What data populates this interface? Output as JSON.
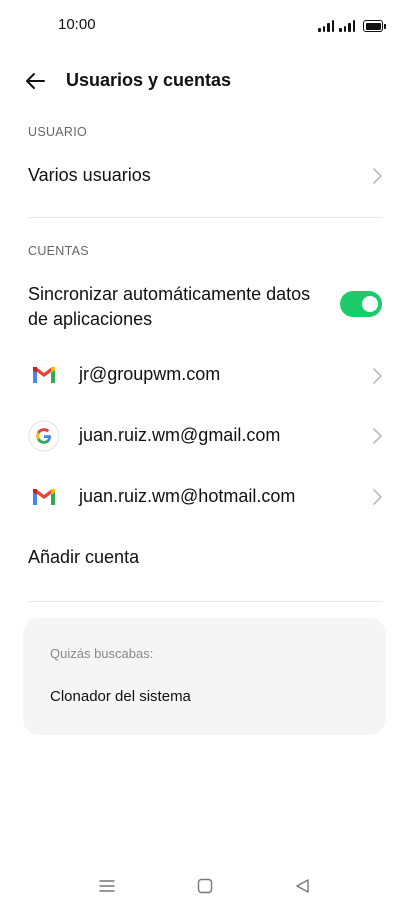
{
  "status_bar": {
    "time": "10:00"
  },
  "header": {
    "title": "Usuarios y cuentas"
  },
  "user_section": {
    "label": "USUARIO",
    "multiple_users": "Varios usuarios"
  },
  "accounts_section": {
    "label": "CUENTAS",
    "sync_label": "Sincronizar automáticamente datos de aplicaciones",
    "sync_enabled": true,
    "accounts": [
      {
        "email": "jr@groupwm.com",
        "icon": "gmail-icon"
      },
      {
        "email": "juan.ruiz.wm@gmail.com",
        "icon": "google-icon"
      },
      {
        "email": "juan.ruiz.wm@hotmail.com",
        "icon": "gmail-icon"
      }
    ],
    "add_account": "Añadir cuenta"
  },
  "suggestion_card": {
    "label": "Quizás buscabas:",
    "item": "Clonador del sistema"
  },
  "colors": {
    "toggle_on": "#1ecb6c",
    "card_bg": "#f5f5f5"
  }
}
